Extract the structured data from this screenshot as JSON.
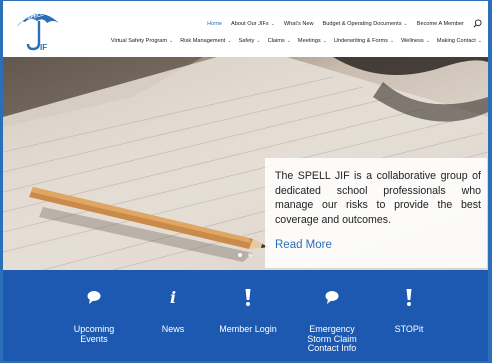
{
  "logo": {
    "name": "SPELL",
    "jif": "JIF"
  },
  "nav_primary": [
    {
      "label": "Home",
      "active": true,
      "dropdown": false
    },
    {
      "label": "About Our JIFs",
      "active": false,
      "dropdown": true
    },
    {
      "label": "What's New",
      "active": false,
      "dropdown": false
    },
    {
      "label": "Budget & Operating Documents",
      "active": false,
      "dropdown": true
    },
    {
      "label": "Become A Member",
      "active": false,
      "dropdown": false
    }
  ],
  "nav_secondary": [
    {
      "label": "Virtual Safety Program",
      "dropdown": true
    },
    {
      "label": "Risk Management",
      "dropdown": true
    },
    {
      "label": "Safety",
      "dropdown": true
    },
    {
      "label": "Claims",
      "dropdown": true
    },
    {
      "label": "Meetings",
      "dropdown": true
    },
    {
      "label": "Underwriting & Forms",
      "dropdown": true
    },
    {
      "label": "Wellness",
      "dropdown": true
    },
    {
      "label": "Making Contact",
      "dropdown": true
    }
  ],
  "hero": {
    "text": "The SPELL JIF is a collaborative group of dedicated school professionals who manage our risks to provide the best coverage and outcomes.",
    "link": "Read More"
  },
  "quick_links": [
    {
      "label": "Upcoming\nEvents",
      "icon": "speech-bubble-icon"
    },
    {
      "label": "News",
      "icon": "info-icon"
    },
    {
      "label": "Member Login",
      "icon": "exclamation-icon"
    },
    {
      "label": "Emergency\nStorm Claim\nContact Info",
      "icon": "speech-bubble-icon"
    },
    {
      "label": "STOPit",
      "icon": "exclamation-icon"
    }
  ],
  "colors": {
    "accent": "#2a6fb8",
    "band": "#1d59b0"
  }
}
